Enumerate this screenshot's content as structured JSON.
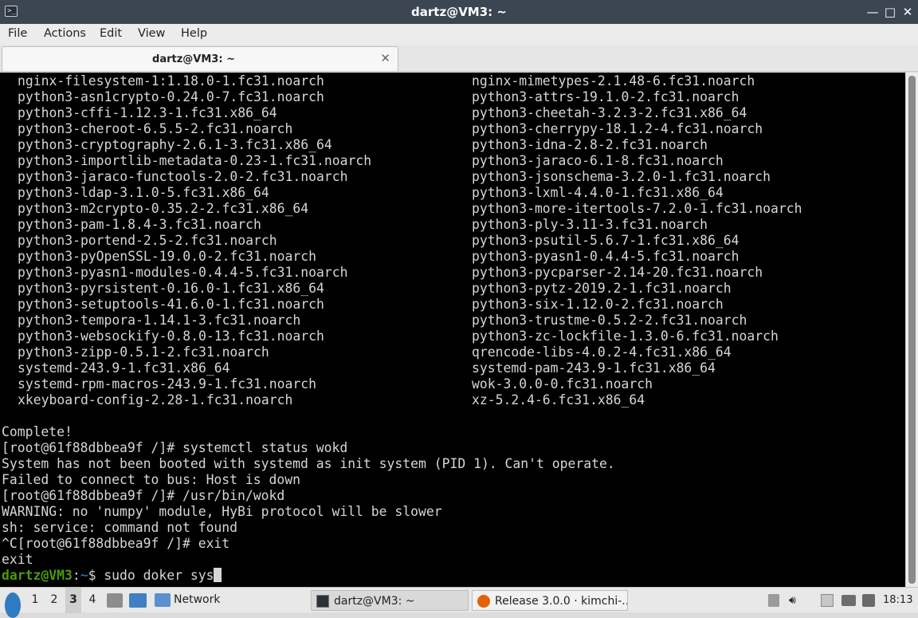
{
  "window": {
    "title": "dartz@VM3: ~",
    "app_icon_glyph": ">_",
    "minimize_glyph": "—",
    "maximize_glyph": "□",
    "close_glyph": "✕"
  },
  "menu": [
    "File",
    "Actions",
    "Edit",
    "View",
    "Help"
  ],
  "tab": {
    "label": "dartz@VM3: ~",
    "close_glyph": "✕"
  },
  "terminal": {
    "packages_left": [
      "nginx-filesystem-1:1.18.0-1.fc31.noarch",
      "python3-asn1crypto-0.24.0-7.fc31.noarch",
      "python3-cffi-1.12.3-1.fc31.x86_64",
      "python3-cheroot-6.5.5-2.fc31.noarch",
      "python3-cryptography-2.6.1-3.fc31.x86_64",
      "python3-importlib-metadata-0.23-1.fc31.noarch",
      "python3-jaraco-functools-2.0-2.fc31.noarch",
      "python3-ldap-3.1.0-5.fc31.x86_64",
      "python3-m2crypto-0.35.2-2.fc31.x86_64",
      "python3-pam-1.8.4-3.fc31.noarch",
      "python3-portend-2.5-2.fc31.noarch",
      "python3-pyOpenSSL-19.0.0-2.fc31.noarch",
      "python3-pyasn1-modules-0.4.4-5.fc31.noarch",
      "python3-pyrsistent-0.16.0-1.fc31.x86_64",
      "python3-setuptools-41.6.0-1.fc31.noarch",
      "python3-tempora-1.14.1-3.fc31.noarch",
      "python3-websockify-0.8.0-13.fc31.noarch",
      "python3-zipp-0.5.1-2.fc31.noarch",
      "systemd-243.9-1.fc31.x86_64",
      "systemd-rpm-macros-243.9-1.fc31.noarch",
      "xkeyboard-config-2.28-1.fc31.noarch"
    ],
    "packages_right": [
      "nginx-mimetypes-2.1.48-6.fc31.noarch",
      "python3-attrs-19.1.0-2.fc31.noarch",
      "python3-cheetah-3.2.3-2.fc31.x86_64",
      "python3-cherrypy-18.1.2-4.fc31.noarch",
      "python3-idna-2.8-2.fc31.noarch",
      "python3-jaraco-6.1-8.fc31.noarch",
      "python3-jsonschema-3.2.0-1.fc31.noarch",
      "python3-lxml-4.4.0-1.fc31.x86_64",
      "python3-more-itertools-7.2.0-1.fc31.noarch",
      "python3-ply-3.11-3.fc31.noarch",
      "python3-psutil-5.6.7-1.fc31.x86_64",
      "python3-pyasn1-0.4.4-5.fc31.noarch",
      "python3-pycparser-2.14-20.fc31.noarch",
      "python3-pytz-2019.2-1.fc31.noarch",
      "python3-six-1.12.0-2.fc31.noarch",
      "python3-trustme-0.5.2-2.fc31.noarch",
      "python3-zc-lockfile-1.3.0-6.fc31.noarch",
      "qrencode-libs-4.0.2-4.fc31.x86_64",
      "systemd-pam-243.9-1.fc31.x86_64",
      "wok-3.0.0-0.fc31.noarch",
      "xz-5.2.4-6.fc31.x86_64"
    ],
    "output": [
      "Complete!",
      "[root@61f88dbbea9f /]# systemctl status wokd",
      "System has not been booted with systemd as init system (PID 1). Can't operate.",
      "Failed to connect to bus: Host is down",
      "[root@61f88dbbea9f /]# /usr/bin/wokd",
      "WARNING: no 'numpy' module, HyBi protocol will be slower",
      "sh: service: command not found",
      "^C[root@61f88dbbea9f /]# exit",
      "exit"
    ],
    "prompt": {
      "user": "dartz@VM3",
      "sep": ":",
      "path": "~",
      "symbol": "$ ",
      "command": "sudo doker sys"
    }
  },
  "taskbar": {
    "workspaces": [
      "1",
      "2",
      "3",
      "4"
    ],
    "active_workspace": "3",
    "folder_label": "Network",
    "tasks": [
      {
        "label": "dartz@VM3: ~",
        "icon": "terminal-icon",
        "active": true
      },
      {
        "label": "Release 3.0.0 · kimchi-...",
        "icon": "firefox-icon",
        "active": false
      }
    ],
    "clock": "18:13"
  },
  "colors": {
    "prompt_user": "#4e9a06",
    "prompt_path": "#3465a4",
    "terminal_bg": "#000000",
    "titlebar_bg": "#3c4552"
  }
}
